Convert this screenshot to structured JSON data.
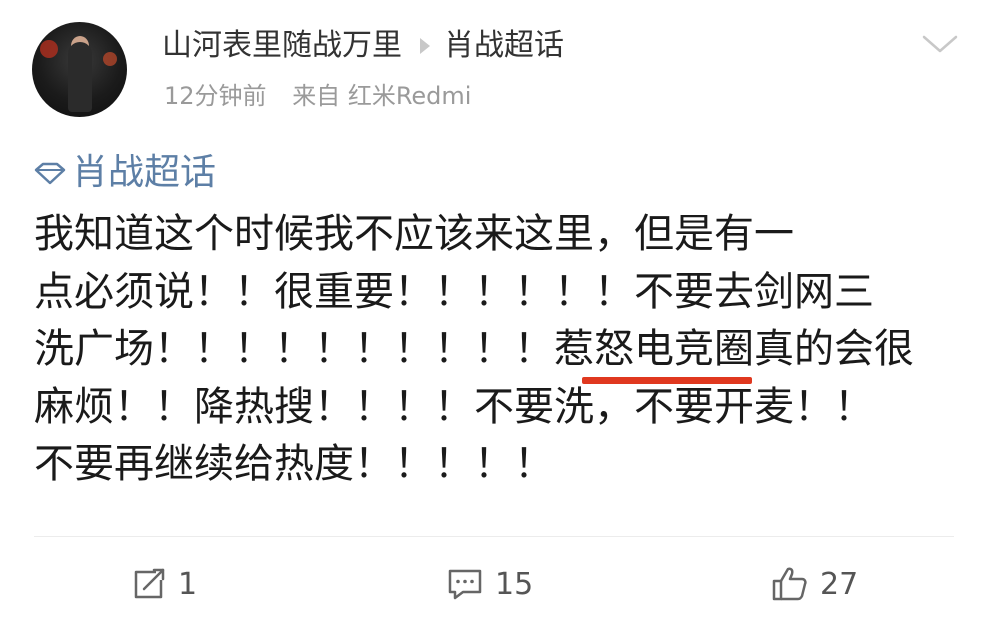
{
  "header": {
    "username": "山河表里随战万里",
    "topic_link": "肖战超话",
    "time": "12分钟前",
    "source": "来自 红米Redmi"
  },
  "post": {
    "topic_tag": "肖战超话",
    "lines": [
      "我知道这个时候我不应该来这里，但是有一",
      "点必须说！！很重要！！！！！！不要去剑网三",
      "洗广场！！！！！！！！！！惹怒电竞圈真的会很",
      "麻烦！！降热搜！！！！不要洗，不要开麦！！",
      "不要再继续给热度！！！！！"
    ],
    "highlight_text": "电竞圈",
    "highlight_color": "#e0381f"
  },
  "actions": {
    "repost_count": "1",
    "comment_count": "15",
    "like_count": "27"
  },
  "icons": {
    "repost": "repost-icon",
    "comment": "comment-icon",
    "like": "thumbs-up-icon",
    "topic": "diamond-icon",
    "menu": "chevron-down-icon"
  },
  "colors": {
    "topic_link": "#5d7fa6",
    "meta_text": "#9a9a9a"
  }
}
